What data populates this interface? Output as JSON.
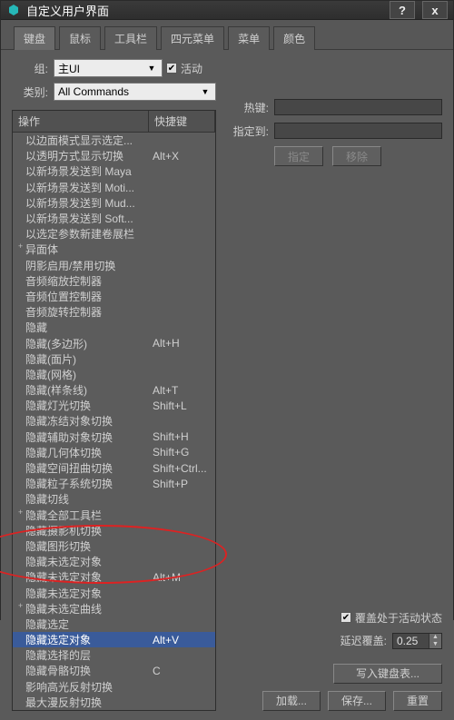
{
  "window": {
    "title": "自定义用户界面",
    "help": "?",
    "close": "x"
  },
  "tabs": [
    "键盘",
    "鼠标",
    "工具栏",
    "四元菜单",
    "菜单",
    "颜色"
  ],
  "active_tab": 0,
  "group": {
    "label": "组:",
    "value": "主UI"
  },
  "active_checkbox": {
    "label": "活动",
    "checked": true
  },
  "category": {
    "label": "类别:",
    "value": "All Commands"
  },
  "list": {
    "header_action": "操作",
    "header_shortcut": "快捷键",
    "rows": [
      {
        "action": "以边面模式显示选定...",
        "shortcut": ""
      },
      {
        "action": "以透明方式显示切换",
        "shortcut": "Alt+X"
      },
      {
        "action": "以新场景发送到 Maya",
        "shortcut": ""
      },
      {
        "action": "以新场景发送到 Moti...",
        "shortcut": ""
      },
      {
        "action": "以新场景发送到 Mud...",
        "shortcut": ""
      },
      {
        "action": "以新场景发送到 Soft...",
        "shortcut": ""
      },
      {
        "action": "以选定参数新建卷展栏",
        "shortcut": ""
      },
      {
        "action": "异面体",
        "shortcut": "",
        "pre": "+"
      },
      {
        "action": "阴影启用/禁用切换",
        "shortcut": ""
      },
      {
        "action": "音频缩放控制器",
        "shortcut": ""
      },
      {
        "action": "音频位置控制器",
        "shortcut": ""
      },
      {
        "action": "音频旋转控制器",
        "shortcut": ""
      },
      {
        "action": "隐藏",
        "shortcut": ""
      },
      {
        "action": "隐藏(多边形)",
        "shortcut": "Alt+H"
      },
      {
        "action": "隐藏(面片)",
        "shortcut": ""
      },
      {
        "action": "隐藏(网格)",
        "shortcut": ""
      },
      {
        "action": "隐藏(样条线)",
        "shortcut": "Alt+T"
      },
      {
        "action": "隐藏灯光切换",
        "shortcut": "Shift+L"
      },
      {
        "action": "隐藏冻结对象切换",
        "shortcut": ""
      },
      {
        "action": "隐藏辅助对象切换",
        "shortcut": "Shift+H"
      },
      {
        "action": "隐藏几何体切换",
        "shortcut": "Shift+G"
      },
      {
        "action": "隐藏空间扭曲切换",
        "shortcut": "Shift+Ctrl..."
      },
      {
        "action": "隐藏粒子系统切换",
        "shortcut": "Shift+P"
      },
      {
        "action": "隐藏切线",
        "shortcut": ""
      },
      {
        "action": "隐藏全部工具栏",
        "shortcut": "",
        "pre": "+"
      },
      {
        "action": "隐藏摄影机切换",
        "shortcut": ""
      },
      {
        "action": "隐藏图形切换",
        "shortcut": ""
      },
      {
        "action": "隐藏未选定对象",
        "shortcut": ""
      },
      {
        "action": "隐藏未选定对象",
        "shortcut": "Alt+M"
      },
      {
        "action": "隐藏未选定对象",
        "shortcut": ""
      },
      {
        "action": "隐藏未选定曲线",
        "shortcut": "",
        "pre": "+"
      },
      {
        "action": "隐藏选定",
        "shortcut": ""
      },
      {
        "action": "隐藏选定对象",
        "shortcut": "Alt+V",
        "selected": true
      },
      {
        "action": "隐藏选择的层",
        "shortcut": ""
      },
      {
        "action": "隐藏骨骼切换",
        "shortcut": "C"
      },
      {
        "action": "影响高光反射切换",
        "shortcut": ""
      },
      {
        "action": "最大漫反射切换",
        "shortcut": ""
      }
    ]
  },
  "right": {
    "hotkey_label": "热键:",
    "assigned_label": "指定到:",
    "assign_btn": "指定",
    "remove_btn": "移除",
    "override_chk": "覆盖处于活动状态",
    "delay_label": "延迟覆盖:",
    "delay_value": "0.25",
    "write_btn": "写入键盘表...",
    "load_btn": "加载...",
    "save_btn": "保存...",
    "reset_btn": "重置"
  }
}
